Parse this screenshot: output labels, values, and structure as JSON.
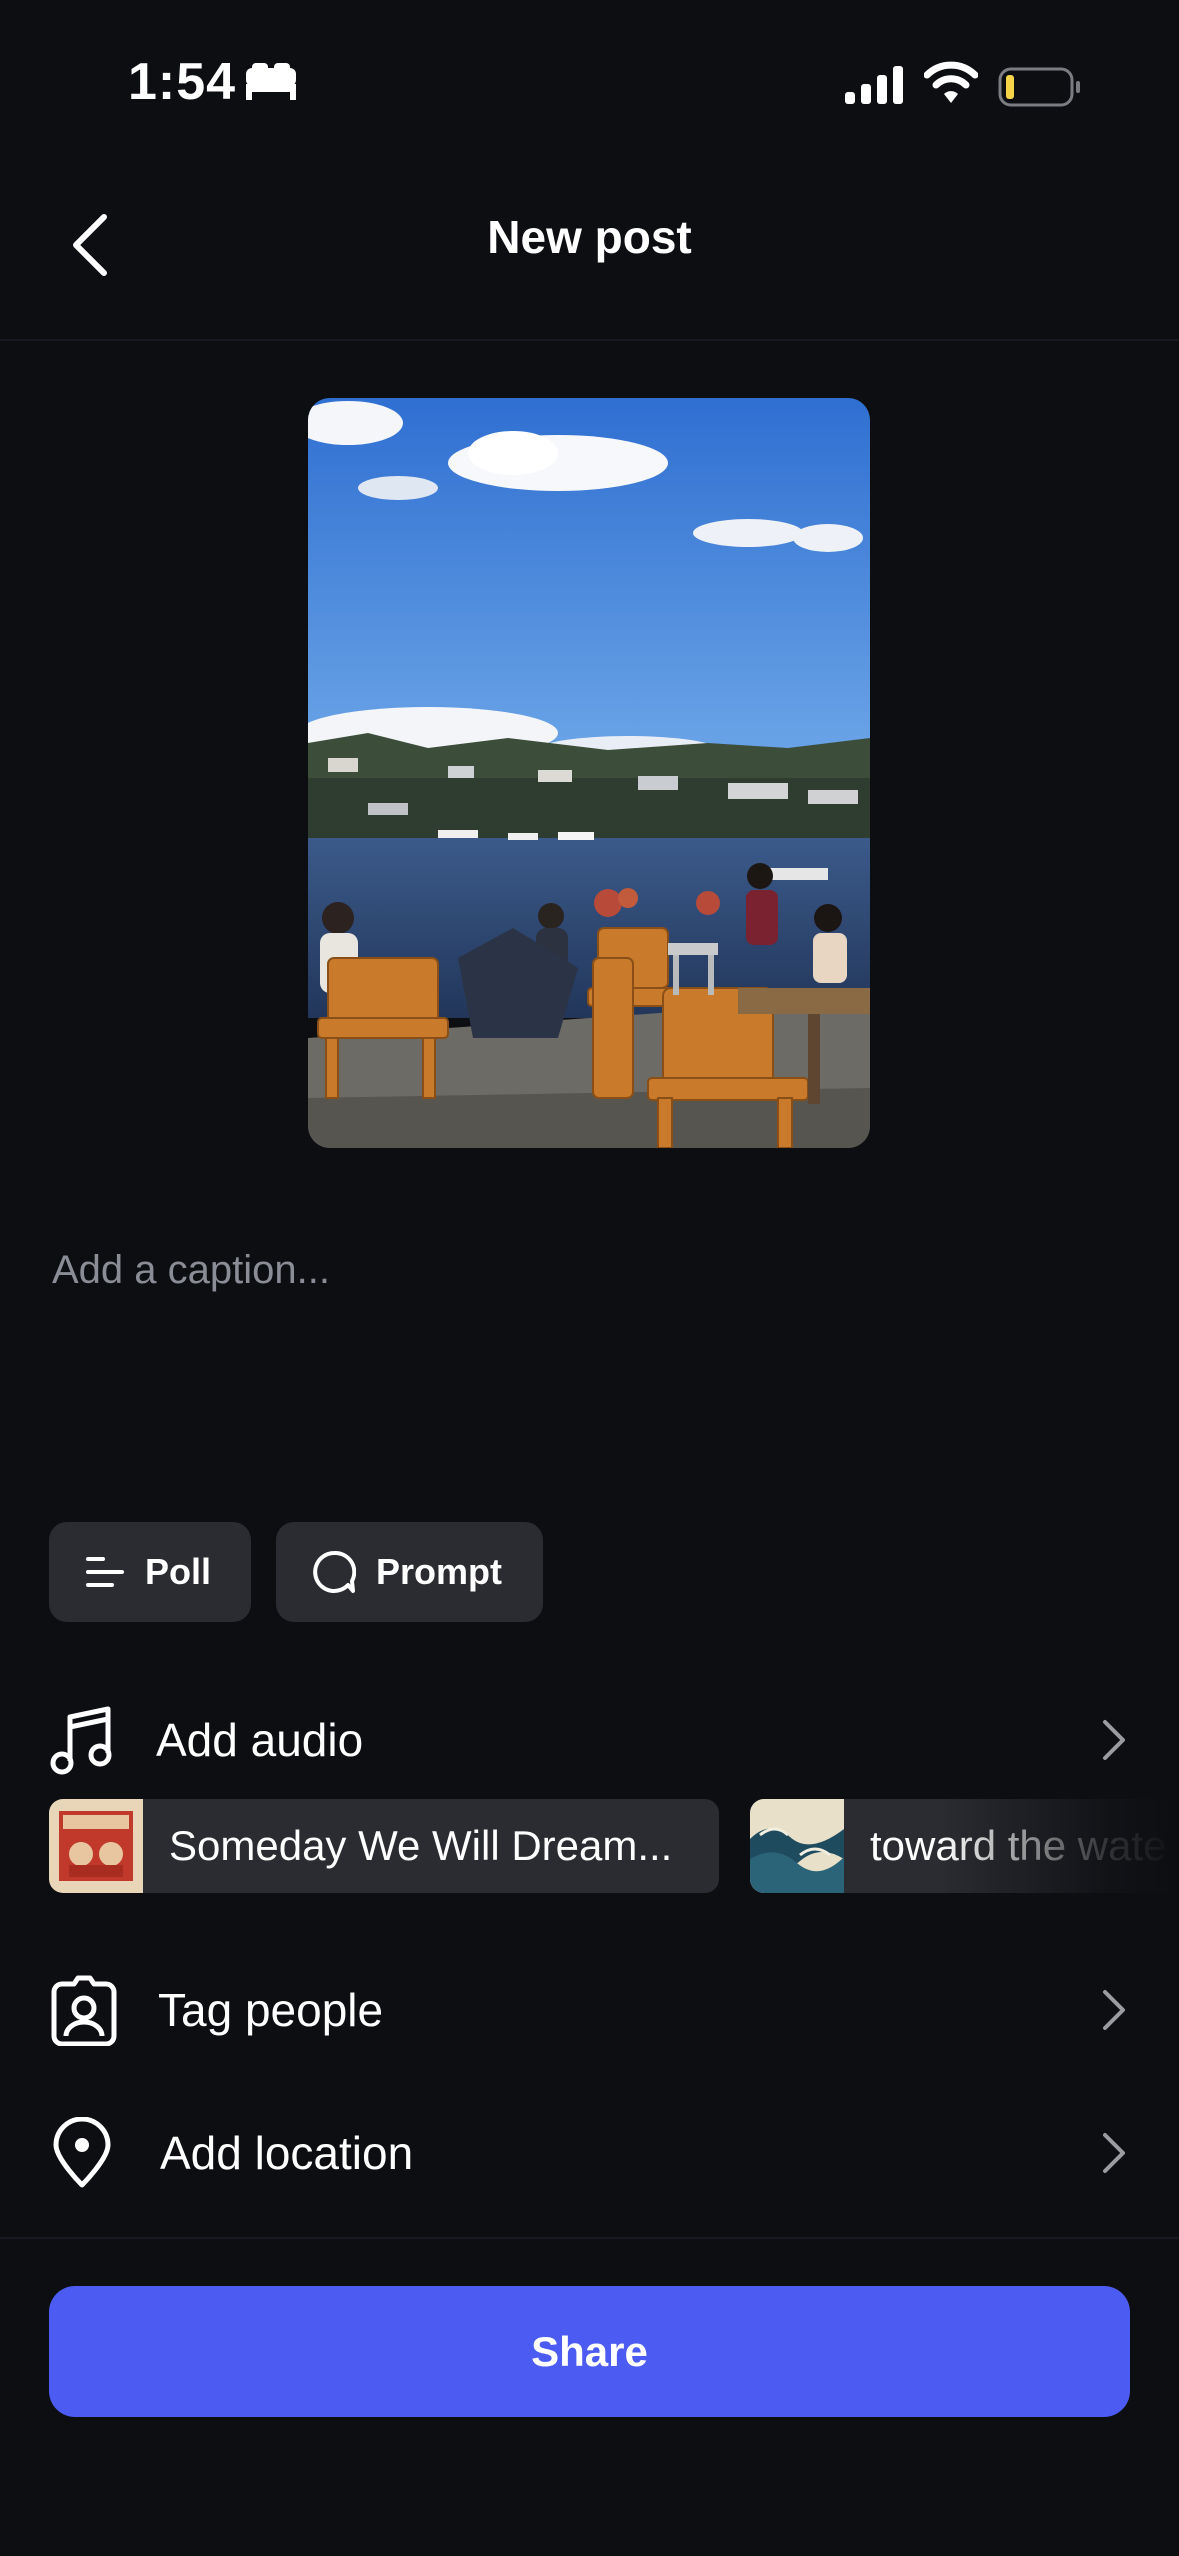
{
  "status_bar": {
    "time": "1:54",
    "icons": [
      "bed-icon",
      "cellular-signal-icon",
      "wifi-icon",
      "battery-low-icon"
    ],
    "battery_color": "#f5d547"
  },
  "header": {
    "back_icon": "chevron-left-icon",
    "title": "New post"
  },
  "photo": {
    "alt": "Lakeside patio with wooden Adirondack chairs, people seated, boats and hillside houses under a blue sky"
  },
  "caption": {
    "placeholder": "Add a caption...",
    "value": ""
  },
  "chips": [
    {
      "icon": "poll-lines-icon",
      "label": "Poll"
    },
    {
      "icon": "speech-bubble-icon",
      "label": "Prompt"
    }
  ],
  "rows": {
    "audio": {
      "icon": "music-note-icon",
      "label": "Add audio"
    },
    "tag": {
      "icon": "tag-person-icon",
      "label": "Tag people"
    },
    "location": {
      "icon": "location-pin-icon",
      "label": "Add location"
    }
  },
  "audio_suggestions": [
    {
      "title": "Someday We Will Dream...",
      "art": "red-album-cover"
    },
    {
      "title": "toward the wate",
      "art": "wave-album-cover"
    }
  ],
  "share_button": {
    "label": "Share"
  },
  "colors": {
    "background": "#0c0e12",
    "chip": "#2a2c31",
    "accent": "#4c5cf2",
    "muted_text": "#8a8d96"
  }
}
